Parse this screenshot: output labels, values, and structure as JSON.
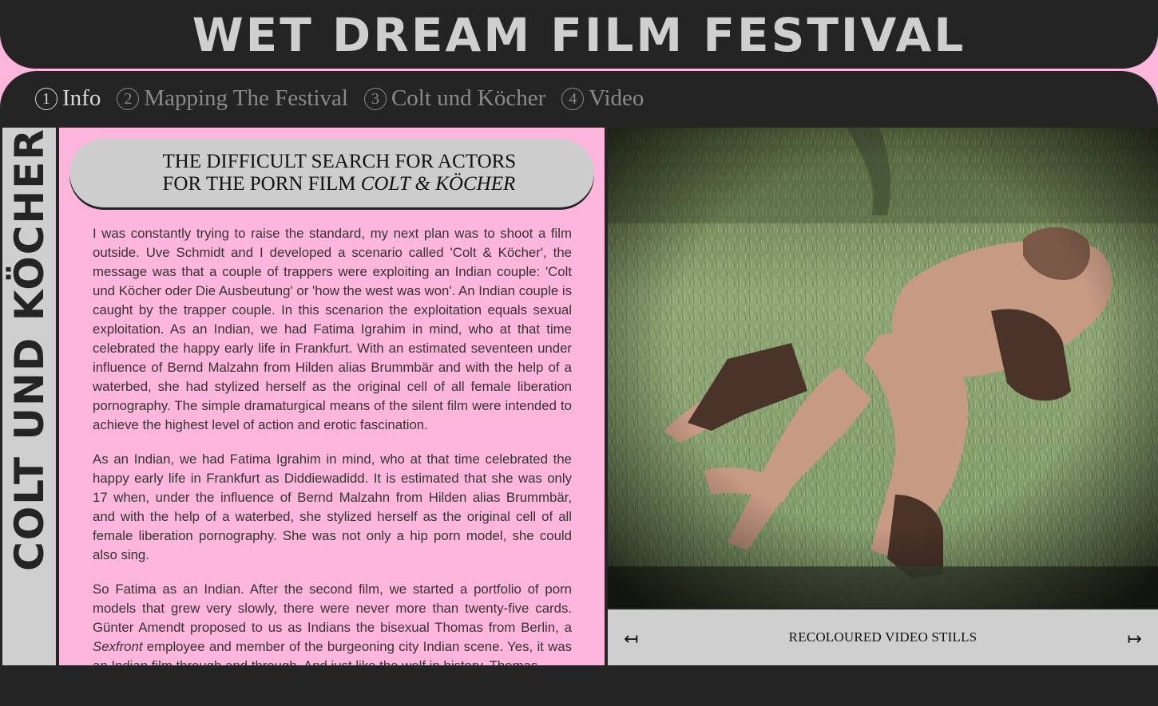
{
  "header": {
    "site_title": "WET DREAM FILM FESTIVAL"
  },
  "nav": {
    "items": [
      {
        "num": "1",
        "label": "Info",
        "active": true
      },
      {
        "num": "2",
        "label": "Mapping The Festival",
        "active": false
      },
      {
        "num": "3",
        "label": "Colt und Köcher",
        "active": false
      },
      {
        "num": "4",
        "label": "Video",
        "active": false
      }
    ]
  },
  "sidebar": {
    "vertical_title": "COLT UND KÖCHER"
  },
  "article": {
    "heading_line1": "THE DIFFICULT SEARCH FOR ACTORS",
    "heading_line2_prefix": "FOR THE PORN FILM ",
    "heading_line2_italic": "COLT & KÖCHER",
    "paragraph1": "I was constantly trying to raise the standard, my next plan was to shoot a film outside. Uve Schmidt and I developed a scenario called 'Colt & Köcher', the message was that a couple of trappers were exploiting an Indian couple: 'Colt und Köcher oder Die Ausbeutung' or 'how the west was won'. An Indian couple is caught by the trapper couple. In this scenarion the exploitation equals sexual exploitation. As an Indian, we had Fatima Igrahim in mind, who at that time celebrated the happy early life in Frankfurt. With an estimated seventeen under influence of Bernd Malzahn from Hilden alias Brummbär and with the help of a waterbed, she had stylized herself as the original cell of all female liberation pornography. The simple dramaturgical means of the silent film were intended to achieve the highest level of action and erotic fascination.",
    "paragraph2": "As an Indian, we had Fatima Igrahim in mind, who at that time celebrated the happy early life in Frankfurt as Diddiewadidd. It is estimated that she was only 17 when, under the influence of Bernd Malzahn from Hilden alias Brummbär, and with the help of a waterbed, she stylized herself as the original cell of all female liberation pornography. She was not only a hip porn model, she could also sing.",
    "paragraph3_before": "So Fatima as an Indian. After the second film, we started a portfolio of porn models that grew very slowly, there were never more than twenty-five cards. Günter Amendt proposed to us as Indians the bisexual Thomas from Berlin, a ",
    "paragraph3_italic": "Sexfront",
    "paragraph3_after": " employee and member of the burgeoning city Indian scene. Yes, it was an Indian film through and through. And just like the wolf in history, Thomas"
  },
  "media": {
    "image_icon": "recoloured-film-still",
    "caption": "RECOLOURED VIDEO STILLS",
    "prev_arrow": "↤",
    "next_arrow": "↦"
  },
  "colors": {
    "dark": "#242424",
    "pink": "#ffb6dd",
    "light_grey": "#cfcfcf",
    "nav_inactive": "#8a8a8a",
    "nav_active": "#d8d8d8"
  }
}
